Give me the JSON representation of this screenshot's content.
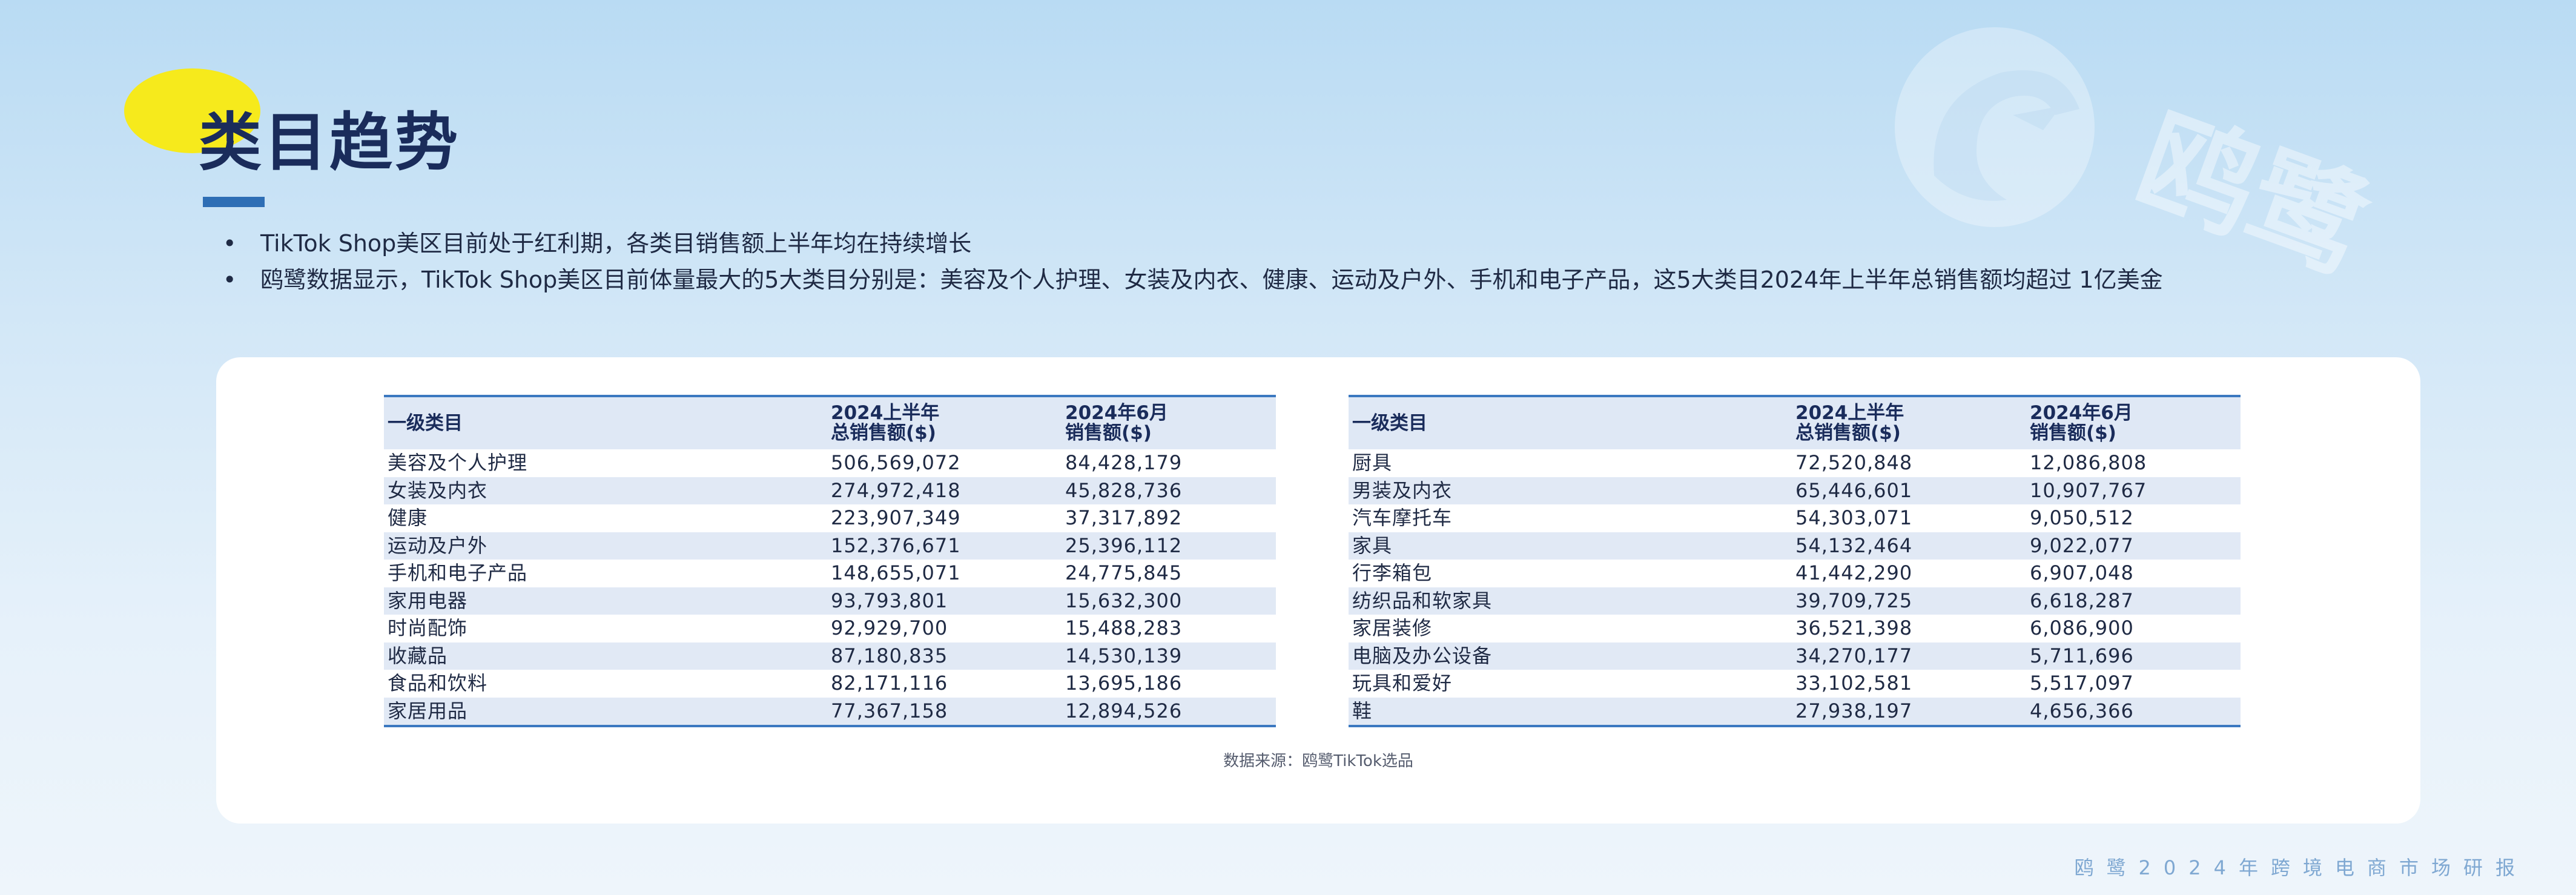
{
  "title": "类目趋势",
  "bullets": [
    "TikTok Shop美区目前处于红利期，各类目销售额上半年均在持续增长",
    "鸥鹭数据显示，TikTok Shop美区目前体量最大的5大类目分别是：美容及个人护理、女装及内衣、健康、运动及户外、手机和电子产品，这5大类目2024年上半年总销售额均超过 1亿美金"
  ],
  "table_headers": {
    "category": "一级类目",
    "h1_line1": "2024上半年",
    "h1_line2": "总销售额($)",
    "june_line1": "2024年6月",
    "june_line2": "销售额($)"
  },
  "left_table": [
    {
      "category": "美容及个人护理",
      "h1_sales": "506,569,072",
      "june_sales": "84,428,179"
    },
    {
      "category": "女装及内衣",
      "h1_sales": "274,972,418",
      "june_sales": "45,828,736"
    },
    {
      "category": "健康",
      "h1_sales": "223,907,349",
      "june_sales": "37,317,892"
    },
    {
      "category": "运动及户外",
      "h1_sales": "152,376,671",
      "june_sales": "25,396,112"
    },
    {
      "category": "手机和电子产品",
      "h1_sales": "148,655,071",
      "june_sales": "24,775,845"
    },
    {
      "category": "家用电器",
      "h1_sales": "93,793,801",
      "june_sales": "15,632,300"
    },
    {
      "category": "时尚配饰",
      "h1_sales": "92,929,700",
      "june_sales": "15,488,283"
    },
    {
      "category": "收藏品",
      "h1_sales": "87,180,835",
      "june_sales": "14,530,139"
    },
    {
      "category": "食品和饮料",
      "h1_sales": "82,171,116",
      "june_sales": "13,695,186"
    },
    {
      "category": "家居用品",
      "h1_sales": "77,367,158",
      "june_sales": "12,894,526"
    }
  ],
  "right_table": [
    {
      "category": "厨具",
      "h1_sales": "72,520,848",
      "june_sales": "12,086,808"
    },
    {
      "category": "男装及内衣",
      "h1_sales": "65,446,601",
      "june_sales": "10,907,767"
    },
    {
      "category": "汽车摩托车",
      "h1_sales": "54,303,071",
      "june_sales": "9,050,512"
    },
    {
      "category": "家具",
      "h1_sales": "54,132,464",
      "june_sales": "9,022,077"
    },
    {
      "category": "行李箱包",
      "h1_sales": "41,442,290",
      "june_sales": "6,907,048"
    },
    {
      "category": "纺织品和软家具",
      "h1_sales": "39,709,725",
      "june_sales": "6,618,287"
    },
    {
      "category": "家居装修",
      "h1_sales": "36,521,398",
      "june_sales": "6,086,900"
    },
    {
      "category": "电脑及办公设备",
      "h1_sales": "34,270,177",
      "june_sales": "5,711,696"
    },
    {
      "category": "玩具和爱好",
      "h1_sales": "33,102,581",
      "june_sales": "5,517,097"
    },
    {
      "category": "鞋",
      "h1_sales": "27,938,197",
      "june_sales": "4,656,366"
    }
  ],
  "source": "数据来源：鸥鹭TikTok选品",
  "watermark_text": "鸥鹭",
  "footer": "鸥鹭2024年跨境电商市场研报",
  "colors": {
    "accent_yellow": "#f6ea1c",
    "title_navy": "#1a2c5b",
    "rule_blue": "#3b78c0",
    "stripe": "#e1e9f5"
  }
}
